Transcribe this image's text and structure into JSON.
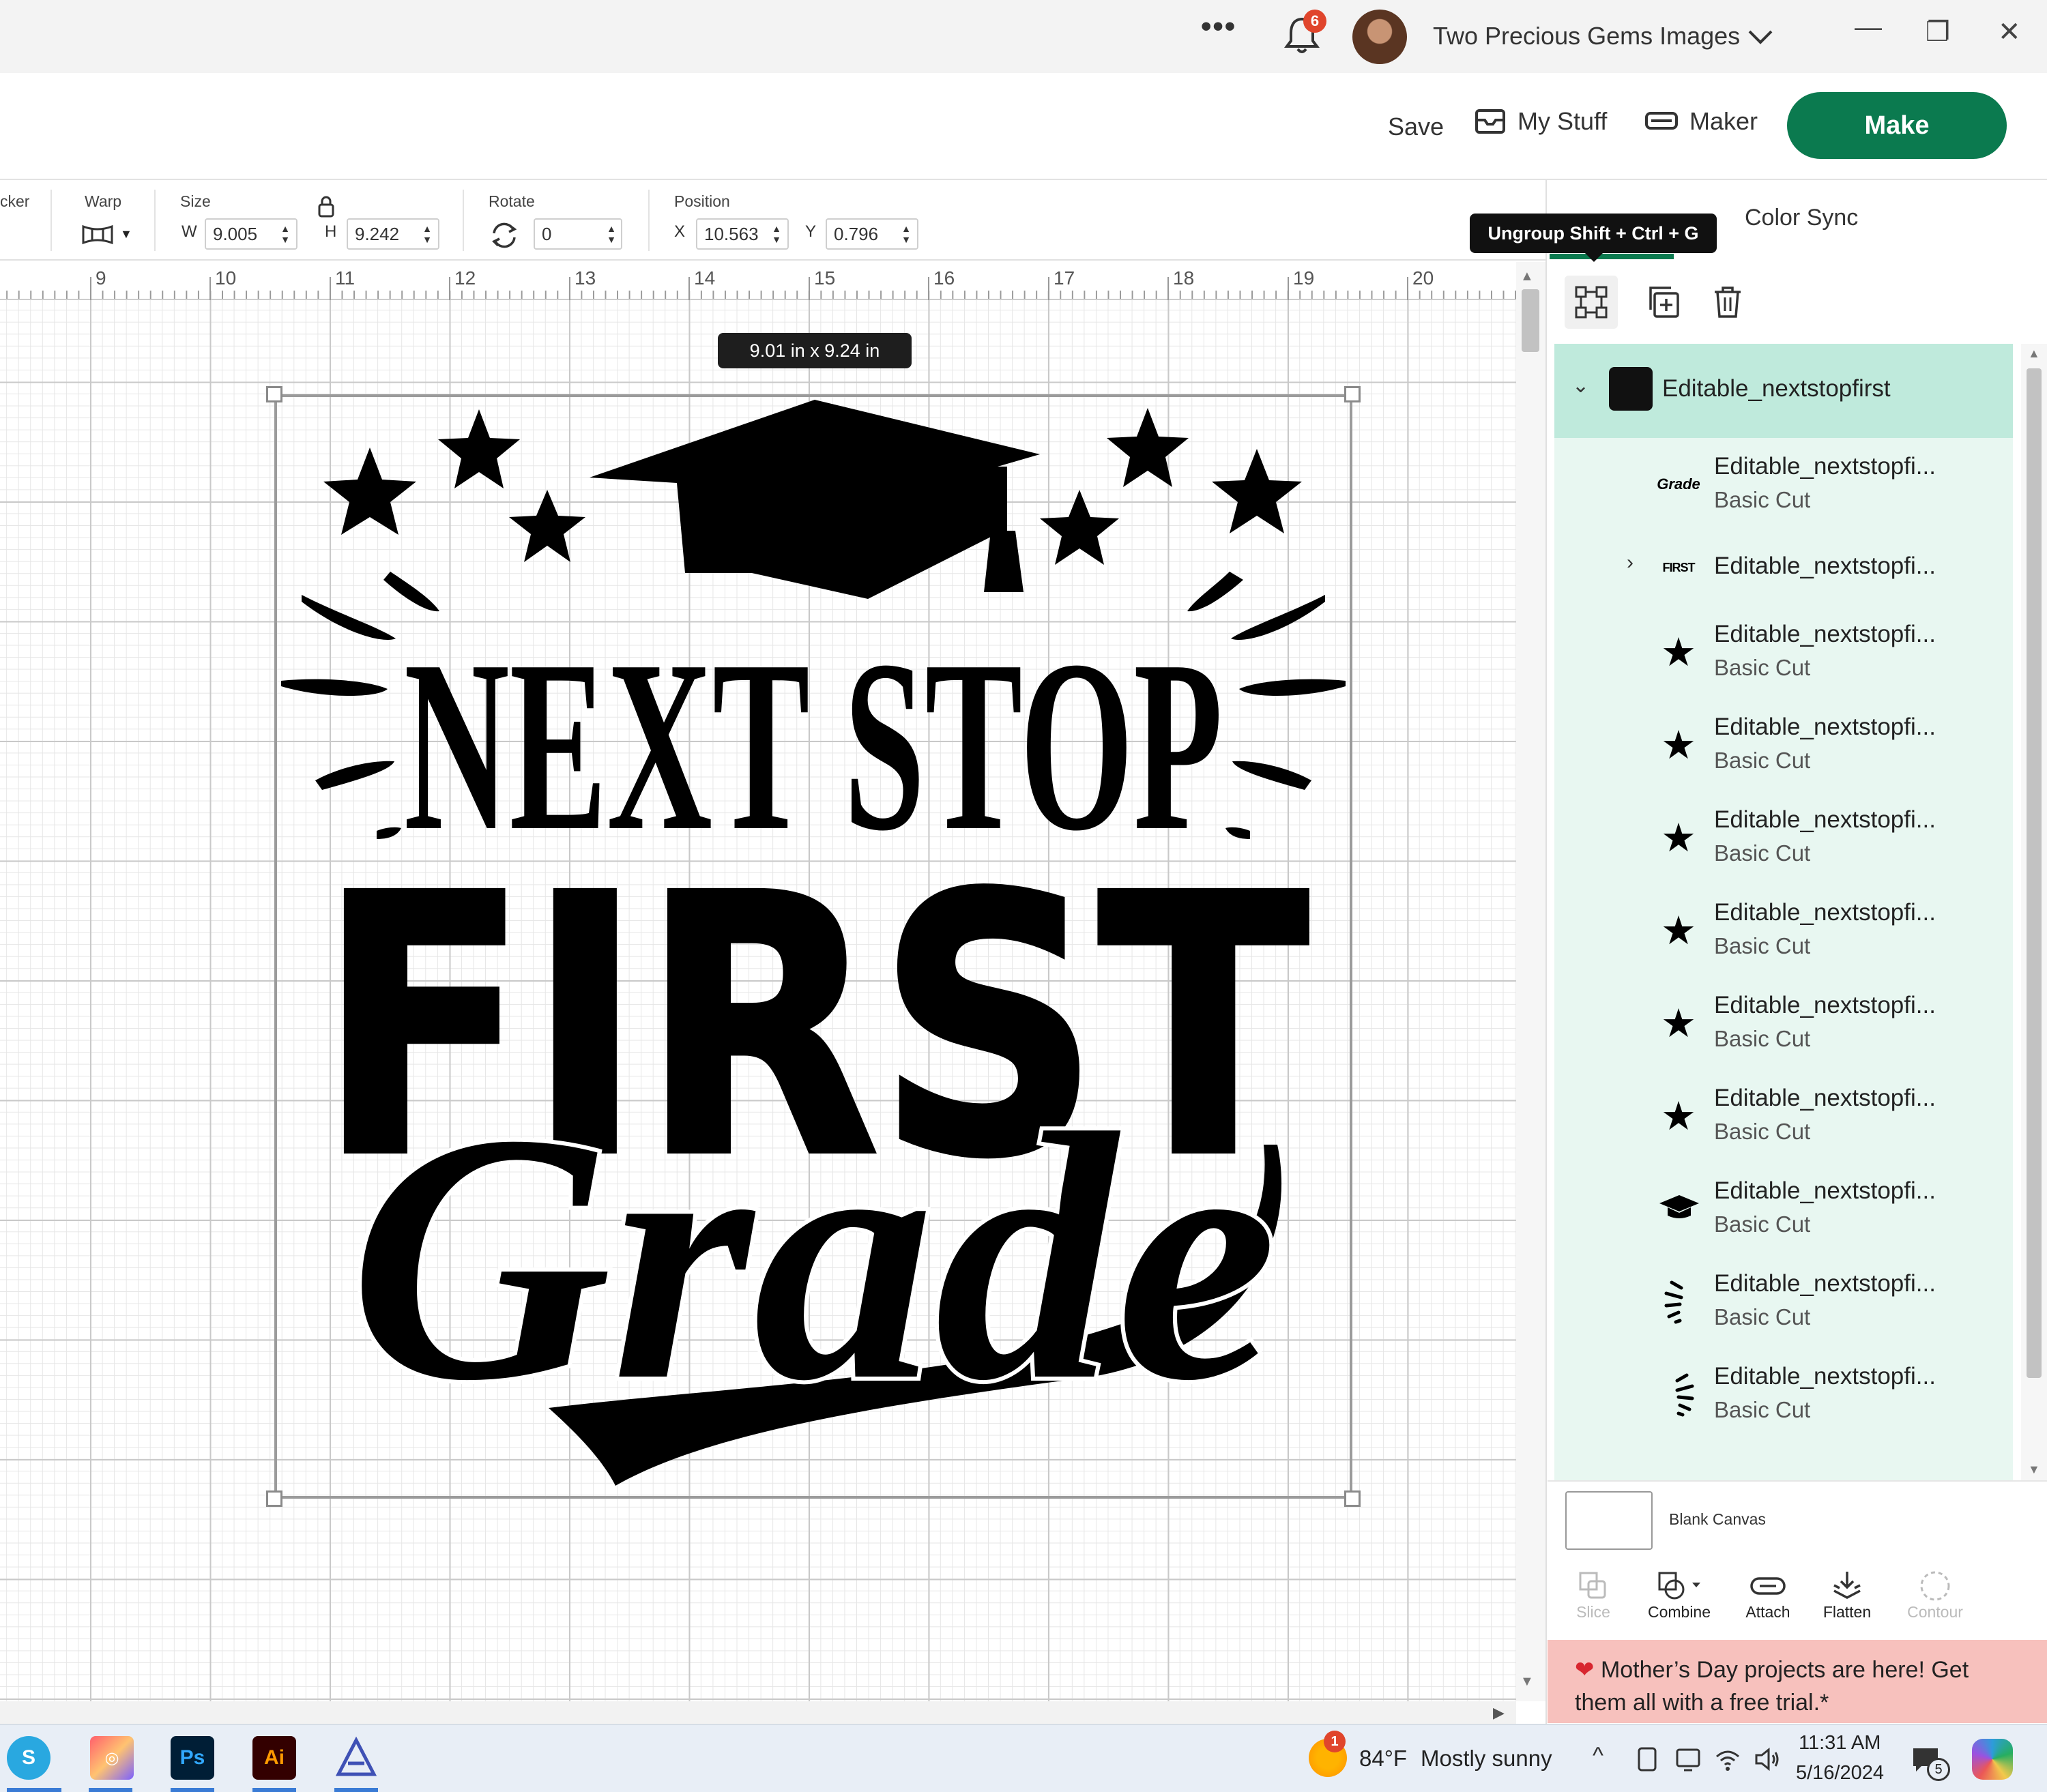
{
  "titlebar": {
    "more_label": "•••",
    "notification_count": "6",
    "account_name": "Two Precious Gems Images",
    "window_minimize": "—",
    "window_restore": "❐",
    "window_close": "✕"
  },
  "topnav": {
    "save_label": "Save",
    "mystuff_label": "My Stuff",
    "maker_label": "Maker",
    "make_label": "Make"
  },
  "toolbar": {
    "offset_label": "cker",
    "warp_label": "Warp",
    "size_label": "Size",
    "w_label": "W",
    "w_value": "9.005",
    "h_label": "H",
    "h_value": "9.242",
    "rotate_label": "Rotate",
    "rotate_value": "0",
    "position_label": "Position",
    "x_label": "X",
    "x_value": "10.563",
    "y_label": "Y",
    "y_value": "0.796"
  },
  "ruler": {
    "ticks": [
      "9",
      "10",
      "11",
      "12",
      "13",
      "14",
      "15",
      "16",
      "17",
      "18",
      "19",
      "20"
    ]
  },
  "canvas": {
    "size_tip": "9.01  in x 9.24  in",
    "design": {
      "line1": "NEXT STOP",
      "line2": "FIRST",
      "line3": "Grade"
    }
  },
  "panel": {
    "tab_color_sync": "Color Sync",
    "tooltip": "Ungroup Shift + Ctrl + G",
    "group_name": "Editable_nextstopfirst",
    "layers": [
      {
        "name": "Editable_nextstopfi...",
        "sub": "Basic Cut",
        "thumb": "Grade"
      },
      {
        "name": "Editable_nextstopfi...",
        "sub": "",
        "thumb": "FIRST"
      },
      {
        "name": "Editable_nextstopfi...",
        "sub": "Basic Cut",
        "thumb": "★"
      },
      {
        "name": "Editable_nextstopfi...",
        "sub": "Basic Cut",
        "thumb": "★"
      },
      {
        "name": "Editable_nextstopfi...",
        "sub": "Basic Cut",
        "thumb": "★"
      },
      {
        "name": "Editable_nextstopfi...",
        "sub": "Basic Cut",
        "thumb": "★"
      },
      {
        "name": "Editable_nextstopfi...",
        "sub": "Basic Cut",
        "thumb": "★"
      },
      {
        "name": "Editable_nextstopfi...",
        "sub": "Basic Cut",
        "thumb": "★"
      },
      {
        "name": "Editable_nextstopfi...",
        "sub": "Basic Cut",
        "thumb": "cap"
      },
      {
        "name": "Editable_nextstopfi...",
        "sub": "Basic Cut",
        "thumb": "dashes"
      },
      {
        "name": "Editable_nextstopfi...",
        "sub": "Basic Cut",
        "thumb": "dashes"
      }
    ],
    "blank_canvas_label": "Blank Canvas",
    "bottom_actions": [
      {
        "label": "Slice",
        "enabled": false
      },
      {
        "label": "Combine",
        "enabled": true
      },
      {
        "label": "Attach",
        "enabled": true
      },
      {
        "label": "Flatten",
        "enabled": true
      },
      {
        "label": "Contour",
        "enabled": false
      }
    ],
    "promo_text": "Mother’s Day projects are here! Get them all with a free trial.*"
  },
  "taskbar": {
    "weather_badge": "1",
    "weather_temp": "84°F",
    "weather_desc": "Mostly sunny",
    "time": "11:31 AM",
    "date": "5/16/2024",
    "notif_count": "5",
    "apps": [
      "S",
      "Creative Cloud",
      "Ps",
      "Ai",
      "Cricut"
    ]
  },
  "colors": {
    "brand_green": "#0b7a4f",
    "layer_group_bg": "#bfeadc",
    "layer_bg": "#e8f7f1",
    "promo_bg": "#f7c1bd"
  }
}
